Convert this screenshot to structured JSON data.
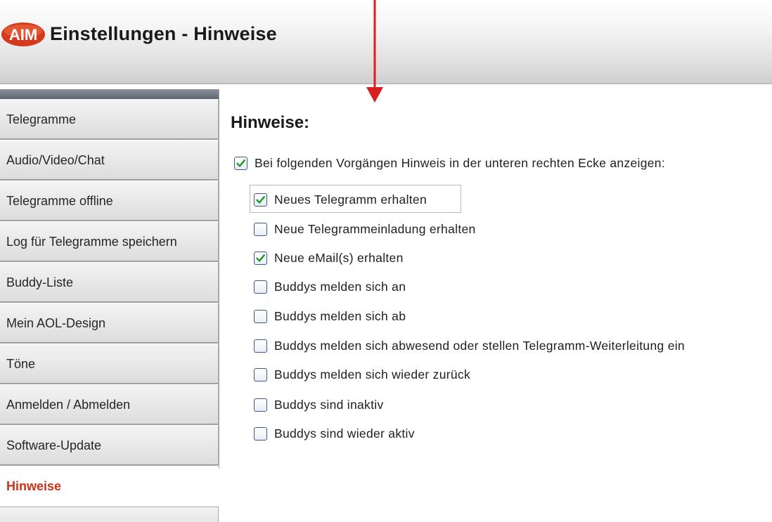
{
  "window": {
    "logo_text": "AIM",
    "title": "Einstellungen - Hinweise"
  },
  "colors": {
    "accent_red": "#c8331a",
    "arrow_red": "#d81e1e",
    "checkbox_border": "#3b5c8a",
    "check_green": "#1f9a2a"
  },
  "sidebar": {
    "items": [
      {
        "label": "Telegramme"
      },
      {
        "label": "Audio/Video/Chat"
      },
      {
        "label": "Telegramme offline"
      },
      {
        "label": "Log für Telegramme speichern"
      },
      {
        "label": "Buddy-Liste"
      },
      {
        "label": "Mein AOL-Design"
      },
      {
        "label": "Töne"
      },
      {
        "label": "Anmelden / Abmelden"
      },
      {
        "label": "Software-Update"
      }
    ],
    "active_label": "Hinweise"
  },
  "main": {
    "heading": "Hinweise:",
    "master": {
      "label": "Bei folgenden Vorgängen Hinweis in der unteren rechten Ecke anzeigen:",
      "checked": true
    },
    "options": [
      {
        "label": "Neues Telegramm erhalten",
        "checked": true
      },
      {
        "label": "Neue Telegrammeinladung erhalten",
        "checked": false
      },
      {
        "label": "Neue eMail(s) erhalten",
        "checked": true
      },
      {
        "label": "Buddys melden sich an",
        "checked": false
      },
      {
        "label": "Buddys melden sich ab",
        "checked": false
      },
      {
        "label": "Buddys melden sich abwesend oder stellen Telegramm-Weiterleitung ein",
        "checked": false
      },
      {
        "label": "Buddys melden sich wieder zurück",
        "checked": false
      },
      {
        "label": "Buddys sind inaktiv",
        "checked": false
      },
      {
        "label": "Buddys sind wieder aktiv",
        "checked": false
      }
    ]
  }
}
